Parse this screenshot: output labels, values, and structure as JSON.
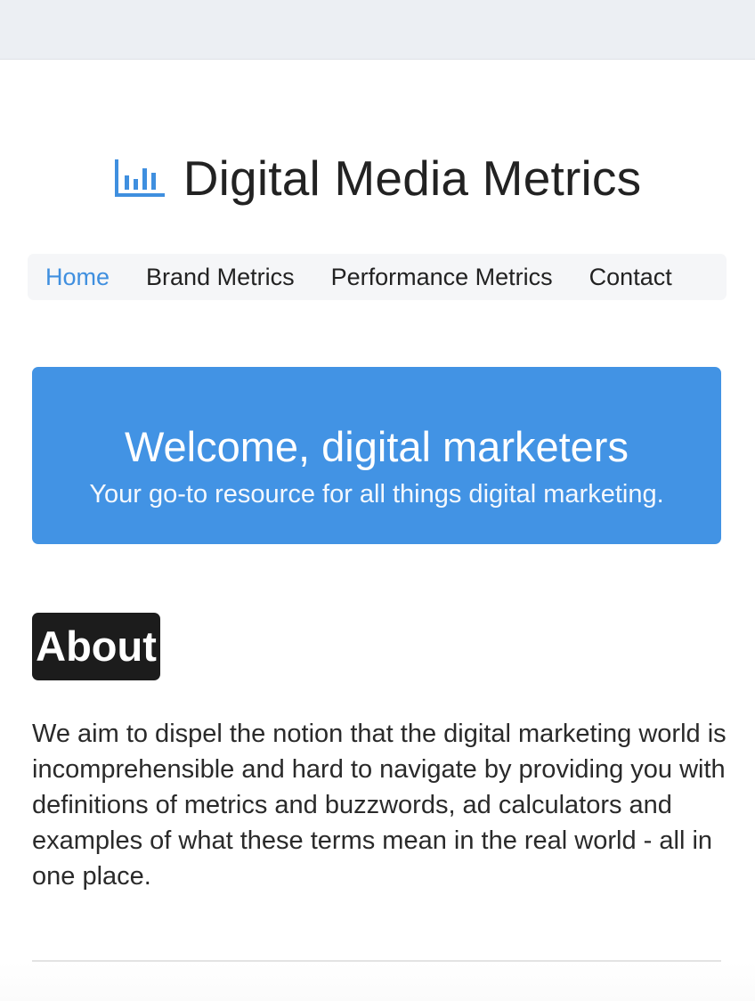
{
  "header": {
    "logo_icon": "bar-chart-icon",
    "title": "Digital Media Metrics"
  },
  "nav": {
    "items": [
      {
        "label": "Home",
        "active": true
      },
      {
        "label": "Brand Metrics",
        "active": false
      },
      {
        "label": "Performance Metrics",
        "active": false
      },
      {
        "label": "Contact",
        "active": false
      }
    ]
  },
  "hero": {
    "title": "Welcome, digital marketers",
    "subtitle": "Your go-to resource for all things digital marketing."
  },
  "about": {
    "heading": "About",
    "body": "We aim to dispel the notion that the digital marketing world is incomprehensible and hard to navigate by providing you with definitions of metrics and buzzwords, ad calculators and examples of what these terms mean in the real world - all in one place."
  },
  "colors": {
    "accent": "#3f8fdf",
    "hero_background": "#4293e4",
    "badge_background": "#1c1c1c",
    "nav_background": "#f5f6f8",
    "top_bar": "#eceff3"
  }
}
